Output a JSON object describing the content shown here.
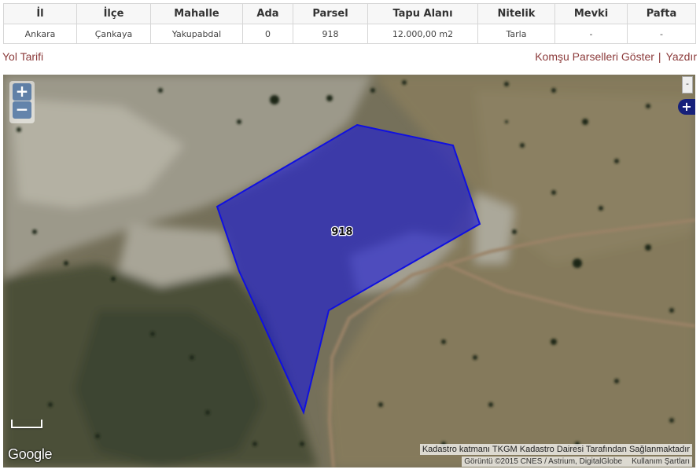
{
  "table": {
    "headers": [
      "İl",
      "İlçe",
      "Mahalle",
      "Ada",
      "Parsel",
      "Tapu Alanı",
      "Nitelik",
      "Mevki",
      "Pafta"
    ],
    "row": [
      "Ankara",
      "Çankaya",
      "Yakupabdal",
      "0",
      "918",
      "12.000,00 m2",
      "Tarla",
      "-",
      "-"
    ]
  },
  "links": {
    "directions": "Yol Tarifi",
    "neighbors": "Komşu Parselleri Göster",
    "separator": "|",
    "print": "Yazdır"
  },
  "map": {
    "parcel_label": "918",
    "parcel_color": "#1a1ad8",
    "zoom_in": "+",
    "zoom_out": "−",
    "layer_collapse": "-",
    "layer_expand": "+",
    "provider": "Google",
    "attribution_layer": "Kadastro katmanı TKGM Kadastro Dairesi Tarafından Sağlanmaktadır",
    "attribution_imagery": "Görüntü ©2015 CNES / Astrium, DigitalGlobe",
    "terms": "Kullanım Şartları"
  }
}
